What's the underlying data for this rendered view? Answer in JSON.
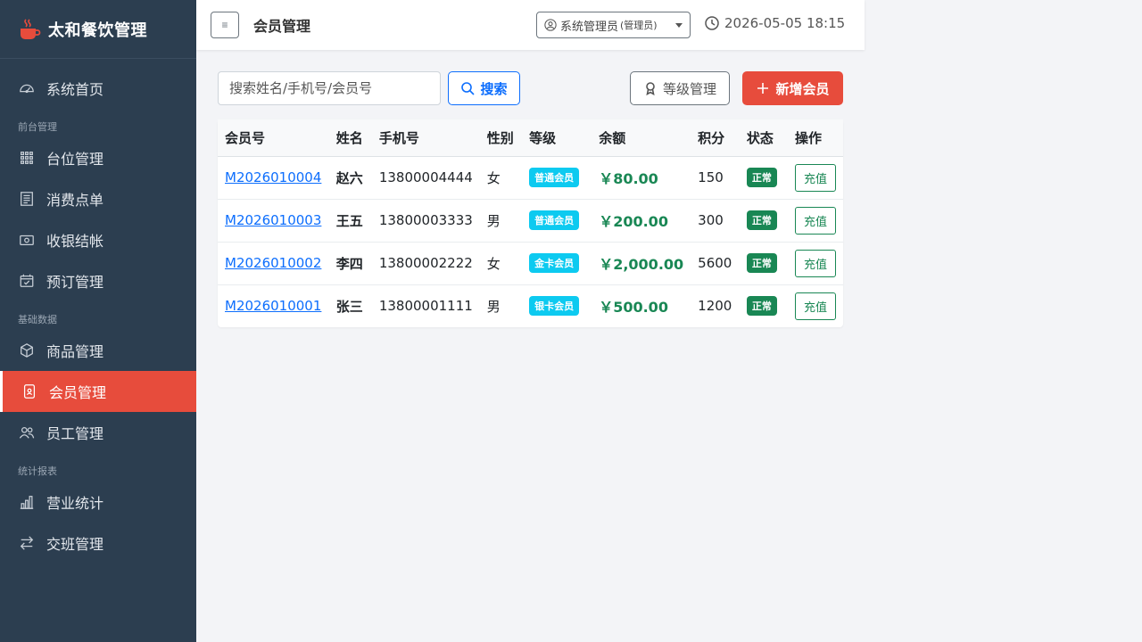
{
  "brand": {
    "title": "太和餐饮管理"
  },
  "sidebar": {
    "items": [
      {
        "label": "系统首页",
        "icon": "dashboard-icon"
      },
      {
        "section": "前台管理"
      },
      {
        "label": "台位管理",
        "icon": "grid-icon"
      },
      {
        "label": "消费点单",
        "icon": "receipt-icon"
      },
      {
        "label": "收银结帐",
        "icon": "cash-icon"
      },
      {
        "label": "预订管理",
        "icon": "calendar-check-icon"
      },
      {
        "section": "基础数据"
      },
      {
        "label": "商品管理",
        "icon": "box-icon"
      },
      {
        "label": "会员管理",
        "icon": "member-card-icon",
        "active": true
      },
      {
        "label": "员工管理",
        "icon": "people-icon"
      },
      {
        "section": "统计报表"
      },
      {
        "label": "营业统计",
        "icon": "bar-chart-icon"
      },
      {
        "label": "交班管理",
        "icon": "swap-icon"
      }
    ]
  },
  "header": {
    "toggle": "≡",
    "title": "会员管理",
    "user": {
      "name": "系统管理员",
      "role": "(管理员)"
    },
    "datetime": "2026-05-05 18:15"
  },
  "toolbar": {
    "search_placeholder": "搜索姓名/手机号/会员号",
    "search_label": "搜索",
    "level_label": "等级管理",
    "add_label": "新增会员"
  },
  "table": {
    "columns": [
      "会员号",
      "姓名",
      "手机号",
      "性别",
      "等级",
      "余额",
      "积分",
      "状态",
      "操作"
    ],
    "rows": [
      {
        "no": "M2026010004",
        "name": "赵六",
        "phone": "13800004444",
        "gender": "女",
        "level": "普通会员",
        "balance": "￥80.00",
        "points": "150",
        "status": "正常",
        "action": "充值"
      },
      {
        "no": "M2026010003",
        "name": "王五",
        "phone": "13800003333",
        "gender": "男",
        "level": "普通会员",
        "balance": "￥200.00",
        "points": "300",
        "status": "正常",
        "action": "充值"
      },
      {
        "no": "M2026010002",
        "name": "李四",
        "phone": "13800002222",
        "gender": "女",
        "level": "金卡会员",
        "balance": "￥2,000.00",
        "points": "5600",
        "status": "正常",
        "action": "充值"
      },
      {
        "no": "M2026010001",
        "name": "张三",
        "phone": "13800001111",
        "gender": "男",
        "level": "银卡会员",
        "balance": "￥500.00",
        "points": "1200",
        "status": "正常",
        "action": "充值"
      }
    ]
  },
  "colors": {
    "sidebar_bg": "#2c3e50",
    "accent": "#e74c3c",
    "primary": "#0d6efd",
    "success": "#198754",
    "info": "#0dcaf0"
  }
}
